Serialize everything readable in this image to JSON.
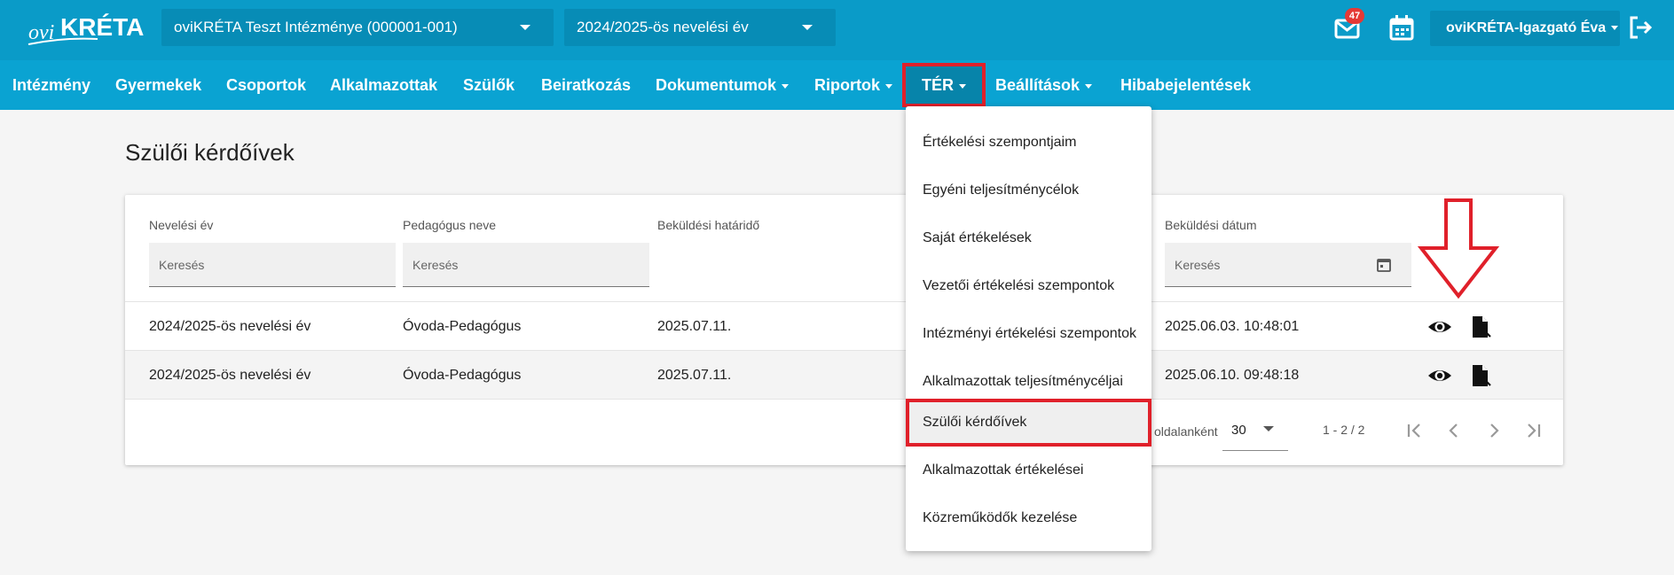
{
  "header": {
    "logo_text": "oviKRÉTA",
    "institution": "oviKRÉTA Teszt Intézménye (000001-001)",
    "school_year": "2024/2025-ös nevelési év",
    "mail_badge": "47",
    "user_name": "oviKRÉTA-Igazgató Éva"
  },
  "nav": {
    "items": [
      {
        "label": "Intézmény",
        "dropdown": false
      },
      {
        "label": "Gyermekek",
        "dropdown": false
      },
      {
        "label": "Csoportok",
        "dropdown": false
      },
      {
        "label": "Alkalmazottak",
        "dropdown": false
      },
      {
        "label": "Szülők",
        "dropdown": false
      },
      {
        "label": "Beiratkozás",
        "dropdown": false
      },
      {
        "label": "Dokumentumok",
        "dropdown": true
      },
      {
        "label": "Riportok",
        "dropdown": true
      },
      {
        "label": "TÉR",
        "dropdown": true,
        "active": true
      },
      {
        "label": "Beállítások",
        "dropdown": true
      },
      {
        "label": "Hibabejelentések",
        "dropdown": false
      }
    ]
  },
  "menu": {
    "items": [
      "Értékelési szempontjaim",
      "Egyéni teljesítménycélok",
      "Saját értékelések",
      "Vezetői értékelési szempontok",
      "Intézményi értékelési szempontok",
      "Alkalmazottak teljesítménycéljai",
      "Szülői kérdőívek",
      "Alkalmazottak értékelései",
      "Közreműködők kezelése"
    ],
    "selected": "Szülői kérdőívek"
  },
  "page": {
    "title": "Szülői kérdőívek"
  },
  "table": {
    "columns": [
      "Nevelési év",
      "Pedagógus neve",
      "Beküldési határidő",
      "Beküldési dátum"
    ],
    "search_placeholder": "Keresés",
    "rows": [
      {
        "year": "2024/2025-ös nevelési év",
        "teacher": "Óvoda-Pedagógus",
        "deadline": "2025.07.11.",
        "sent": "2025.06.03. 10:48:01"
      },
      {
        "year": "2024/2025-ös nevelési év",
        "teacher": "Óvoda-Pedagógus",
        "deadline": "2025.07.11.",
        "sent": "2025.06.10. 09:48:18"
      }
    ],
    "per_page_label": "oldalanként",
    "per_page": "30",
    "range": "1 - 2 / 2"
  },
  "colors": {
    "topbar": "#0a9bc8",
    "navbar": "#0aa3d2",
    "highlight": "#e0202a"
  }
}
